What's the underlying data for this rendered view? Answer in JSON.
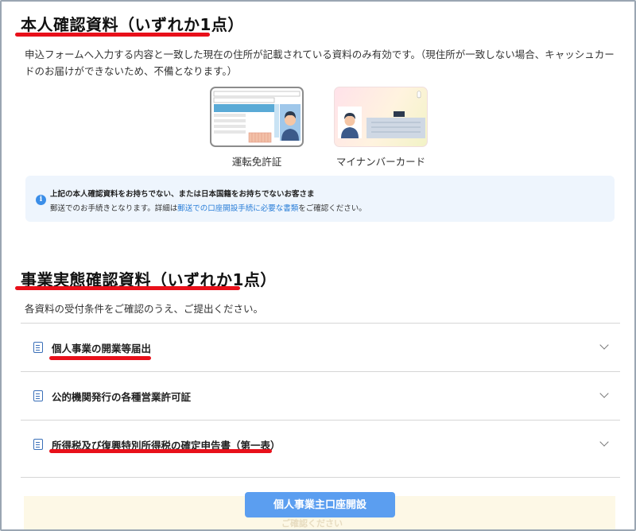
{
  "identity": {
    "title": "本人確認資料（いずれか1点）",
    "description": "申込フォームへ入力する内容と一致した現在の住所が記載されている資料のみ有効です。（現住所が一致しない場合、キャッシュカードのお届けができないため、不備となります。）",
    "cards": [
      {
        "label": "運転免許証",
        "icon": "drivers-license-card"
      },
      {
        "label": "マイナンバーカード",
        "icon": "my-number-card"
      }
    ],
    "license_side_text": "運転免許証",
    "notice": {
      "icon": "info-icon",
      "line1": "上記の本人確認資料をお持ちでない、または日本国籍をお持ちでないお客さま",
      "line2_prefix": "郵送でのお手続きとなります。詳細は",
      "line2_link": "郵送での口座開設手続に必要な書類",
      "line2_suffix": "をご確認ください。"
    }
  },
  "business": {
    "title": "事業実態確認資料（いずれか1点）",
    "description": "各資料の受付条件をご確認のうえ、ご提出ください。",
    "items": [
      {
        "label": "個人事業の開業等届出",
        "icon": "document-icon",
        "expanded": false
      },
      {
        "label": "公的機関発行の各種営業許可証",
        "icon": "document-icon",
        "expanded": false
      },
      {
        "label": "所得税及び復興特別所得税の確定申告書（第一表）",
        "icon": "document-icon",
        "expanded": false
      }
    ]
  },
  "footer": {
    "cta_label": "個人事業主口座開設",
    "ghost_text": "ご確認ください"
  },
  "colors": {
    "highlight_underline": "#e8101a",
    "link": "#2a7ed8",
    "cta": "#5b9ef0",
    "notice_bg": "#eef5fd"
  }
}
